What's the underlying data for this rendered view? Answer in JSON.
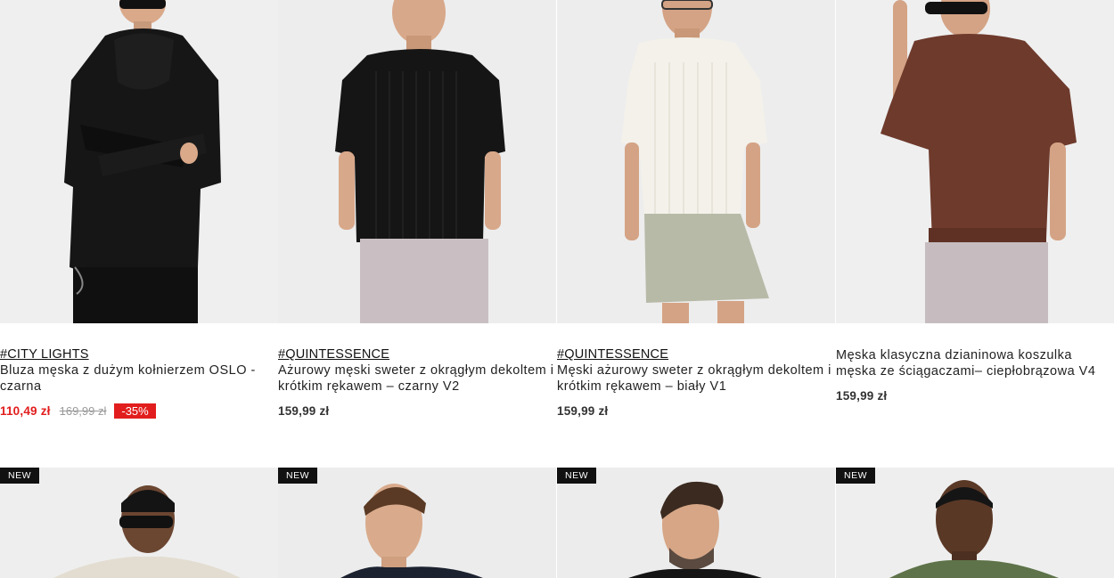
{
  "products_row1": [
    {
      "tag": "#CITY LIGHTS",
      "name": "Bluza męska z dużym kołnierzem OSLO - czarna",
      "price": "110,49 zł",
      "old_price": "169,99 zł",
      "discount": "-35%",
      "garment_color": "#161616",
      "bottom_color": "#101010"
    },
    {
      "tag": "#QUINTESSENCE",
      "name": "Ażurowy męski sweter z okrągłym dekoltem i krótkim rękawem – czarny V2",
      "price": "159,99 zł",
      "garment_color": "#151515",
      "bottom_color": "#c9bfc2"
    },
    {
      "tag": "#QUINTESSENCE",
      "name": "Męski ażurowy sweter z okrągłym dekoltem i krótkim rękawem – biały V1",
      "price": "159,99 zł",
      "garment_color": "#f3f1ea",
      "bottom_color": "#b8baa8"
    },
    {
      "name": "Męska klasyczna dzianinowa koszulka męska ze ściągaczami– ciepłobrązowa V4",
      "price": "159,99 zł",
      "garment_color": "#6e3a2c",
      "bottom_color": "#c6bcbf"
    }
  ],
  "products_row2": [
    {
      "badge": "NEW",
      "garment_color": "#e3ddd1"
    },
    {
      "badge": "NEW",
      "garment_color": "#1c2230"
    },
    {
      "badge": "NEW",
      "garment_color": "#151515"
    },
    {
      "badge": "NEW",
      "garment_color": "#5e7349"
    }
  ],
  "colors": {
    "sale_red": "#e21d1d",
    "photo_bg": "#eeeeee",
    "skin": "#d9a98a"
  }
}
